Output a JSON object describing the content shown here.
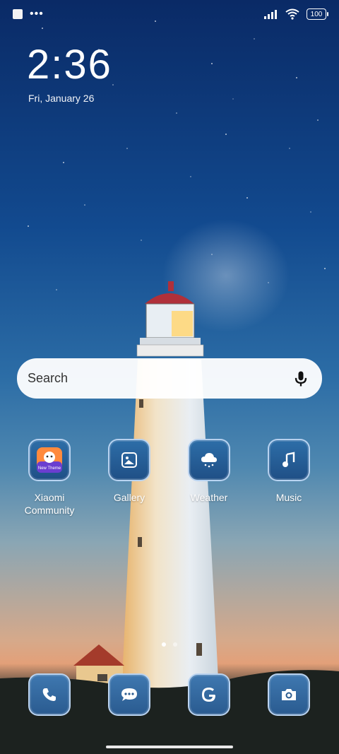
{
  "status_bar": {
    "battery": "100"
  },
  "lock_widget": {
    "time": "2:36",
    "date": "Fri, January 26"
  },
  "search": {
    "placeholder": "Search"
  },
  "apps": [
    {
      "label": "Xiaomi\nCommunity",
      "icon": "xiaomi-community-icon"
    },
    {
      "label": "Gallery",
      "icon": "gallery-icon"
    },
    {
      "label": "Weather",
      "icon": "weather-icon"
    },
    {
      "label": "Music",
      "icon": "music-icon"
    }
  ],
  "dock": [
    {
      "icon": "phone-icon"
    },
    {
      "icon": "messages-icon"
    },
    {
      "icon": "google-icon"
    },
    {
      "icon": "camera-icon"
    }
  ],
  "pages": {
    "count": 2,
    "active": 1
  },
  "colors": {
    "sky_top": "#0a2a66",
    "sky_mid": "#2c6da6",
    "horizon": "#e3a079",
    "icon_bg": "#1f4f86"
  }
}
